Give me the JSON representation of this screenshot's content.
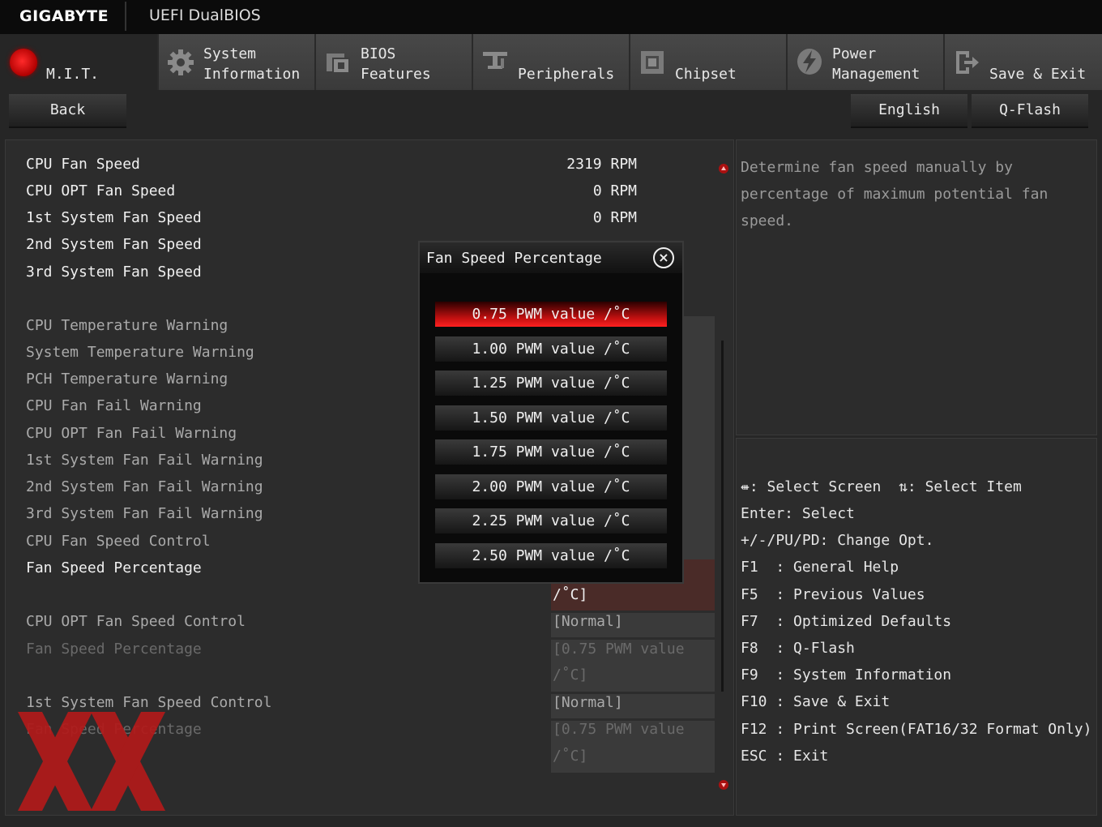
{
  "header": {
    "brand": "GIGABYTE",
    "title": "UEFI DualBIOS"
  },
  "tabs": [
    {
      "line1": "",
      "line2": "M.I.T.",
      "icon": "mit-orb-icon",
      "active": true
    },
    {
      "line1": "System",
      "line2": "Information",
      "icon": "gear-icon"
    },
    {
      "line1": "BIOS",
      "line2": "Features",
      "icon": "bios-features-icon"
    },
    {
      "line1": "",
      "line2": "Peripherals",
      "icon": "peripherals-icon"
    },
    {
      "line1": "",
      "line2": "Chipset",
      "icon": "chipset-icon"
    },
    {
      "line1": "Power",
      "line2": "Management",
      "icon": "power-icon"
    },
    {
      "line1": "",
      "line2": "Save & Exit",
      "icon": "exit-door-icon"
    }
  ],
  "toolbar": {
    "back": "Back",
    "language": "English",
    "qflash": "Q-Flash"
  },
  "monitor": [
    {
      "label": "CPU Fan Speed",
      "value": "2319 RPM"
    },
    {
      "label": "CPU OPT Fan Speed",
      "value": "0 RPM"
    },
    {
      "label": "1st System Fan Speed",
      "value": "0 RPM"
    },
    {
      "label": "2nd System Fan Speed",
      "value": ""
    },
    {
      "label": "3rd System Fan Speed",
      "value": ""
    }
  ],
  "settings": [
    {
      "label": "CPU Temperature Warning"
    },
    {
      "label": "System Temperature Warning"
    },
    {
      "label": "PCH Temperature Warning"
    },
    {
      "label": "CPU Fan Fail Warning"
    },
    {
      "label": "CPU OPT Fan Fail Warning"
    },
    {
      "label": "1st System Fan Fail Warning"
    },
    {
      "label": "2nd System Fan Fail Warning"
    },
    {
      "label": "3rd System Fan Fail Warning"
    },
    {
      "label": "CPU Fan Speed Control"
    },
    {
      "label": "Fan Speed Percentage",
      "value_tail": "/˚C]"
    },
    {
      "label": "CPU OPT Fan Speed Control",
      "value": "[Normal]"
    },
    {
      "label": "Fan Speed Percentage",
      "value": "[0.75 PWM value",
      "value_tail": "/˚C]"
    },
    {
      "label": "1st System Fan Speed Control",
      "value": "[Normal]"
    },
    {
      "label": "Fan Speed Percentage",
      "value": "[0.75 PWM value",
      "value_tail": "/˚C]"
    }
  ],
  "help": "Determine fan speed manually by percentage of maximum potential fan speed.",
  "keys": [
    "⇺: Select Screen  ⇅: Select Item",
    "Enter: Select",
    "+/-/PU/PD: Change Opt.",
    "F1  : General Help",
    "F5  : Previous Values",
    "F7  : Optimized Defaults",
    "F8  : Q-Flash",
    "F9  : System Information",
    "F10 : Save & Exit",
    "F12 : Print Screen(FAT16/32 Format Only)",
    "ESC : Exit"
  ],
  "popup": {
    "title": "Fan Speed Percentage",
    "selected_index": 0,
    "options": [
      "0.75 PWM value /˚C",
      "1.00 PWM value /˚C",
      "1.25 PWM value /˚C",
      "1.50 PWM value /˚C",
      "1.75 PWM value /˚C",
      "2.00 PWM value /˚C",
      "2.25 PWM value /˚C",
      "2.50 PWM value /˚C"
    ]
  },
  "colors": {
    "accent": "#d01010",
    "background": "#262626",
    "panel": "#2c2c2c"
  }
}
